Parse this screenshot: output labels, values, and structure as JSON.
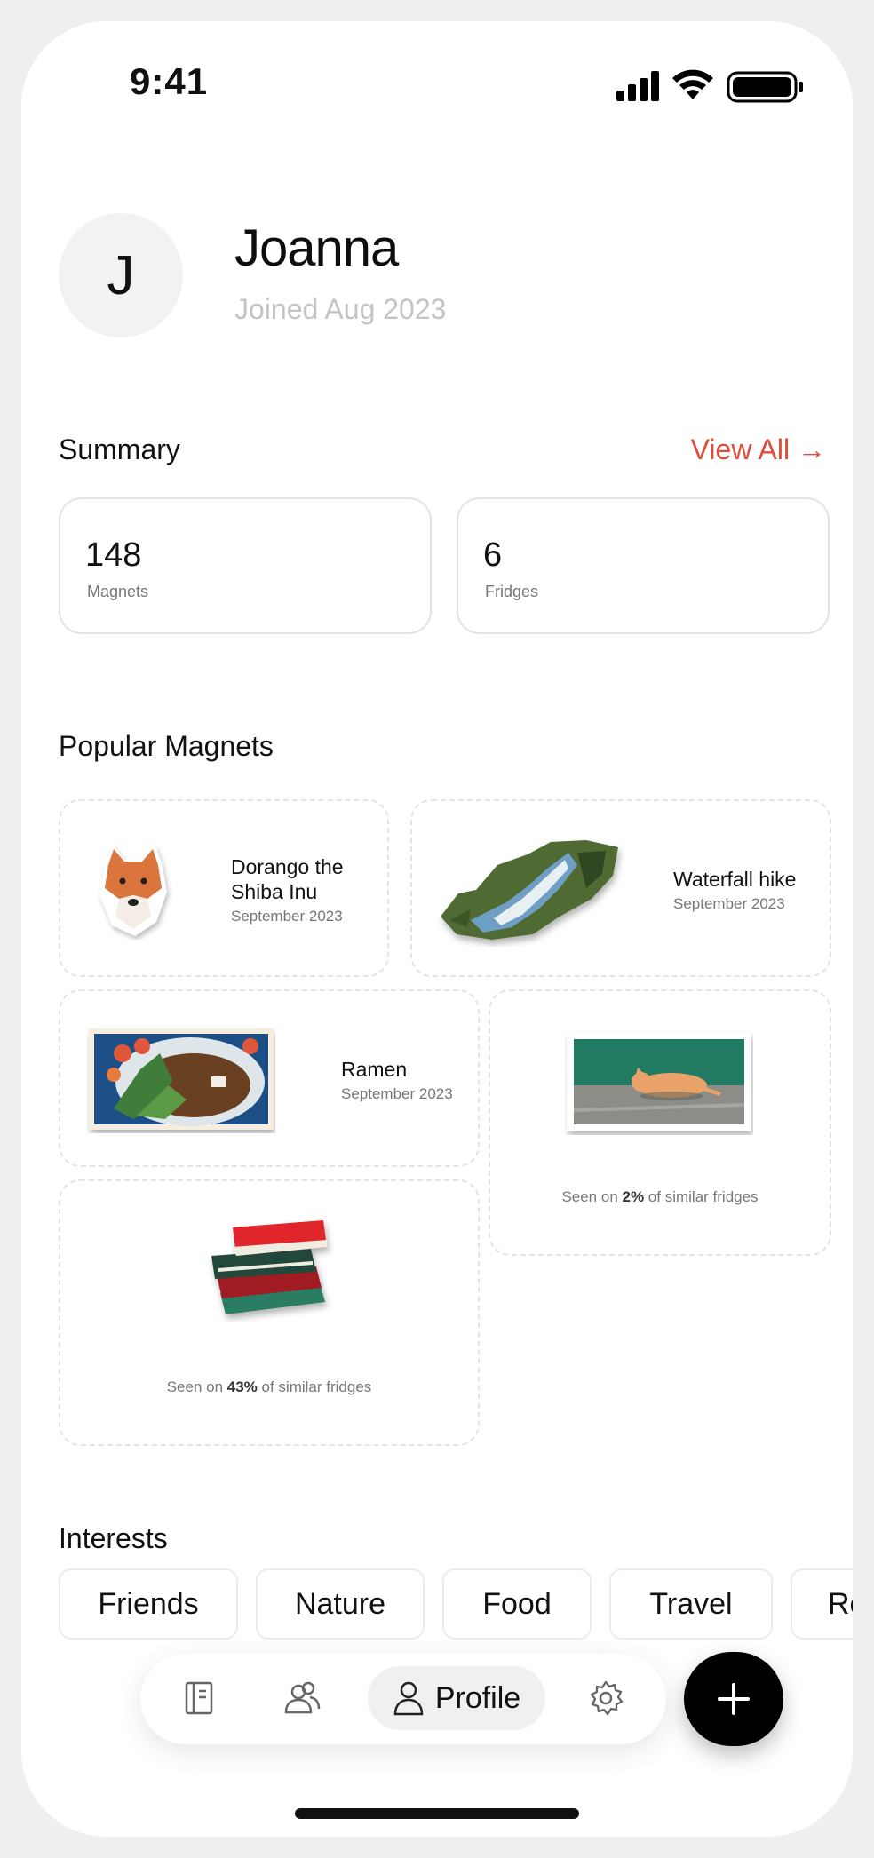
{
  "status_bar": {
    "time": "9:41"
  },
  "profile": {
    "initial": "J",
    "name": "Joanna",
    "joined": "Joined Aug 2023"
  },
  "summary": {
    "title": "Summary",
    "view_all": "View All →",
    "stats": [
      {
        "value": "148",
        "label": "Magnets"
      },
      {
        "value": "6",
        "label": "Fridges"
      }
    ]
  },
  "popular": {
    "title": "Popular Magnets",
    "items": [
      {
        "title": "Dorango the Shiba Inu",
        "date": "September 2023",
        "icon": "shiba-inu-magnet"
      },
      {
        "title": "Waterfall hike",
        "date": "September 2023",
        "icon": "waterfall-magnet"
      },
      {
        "title": "Ramen",
        "date": "September 2023",
        "icon": "ramen-magnet"
      },
      {
        "seen_prefix": "Seen on ",
        "seen_percent": "2%",
        "seen_suffix": " of similar fridges",
        "icon": "cat-photo-magnet"
      },
      {
        "seen_prefix": "Seen on ",
        "seen_percent": "43%",
        "seen_suffix": " of similar fridges",
        "icon": "books-magnet"
      }
    ]
  },
  "interests": {
    "title": "Interests",
    "chips": [
      "Friends",
      "Nature",
      "Food",
      "Travel",
      "Re"
    ]
  },
  "nav": {
    "active_label": "Profile"
  },
  "colors": {
    "accent": "#e04b3a",
    "fab": "#000000"
  }
}
